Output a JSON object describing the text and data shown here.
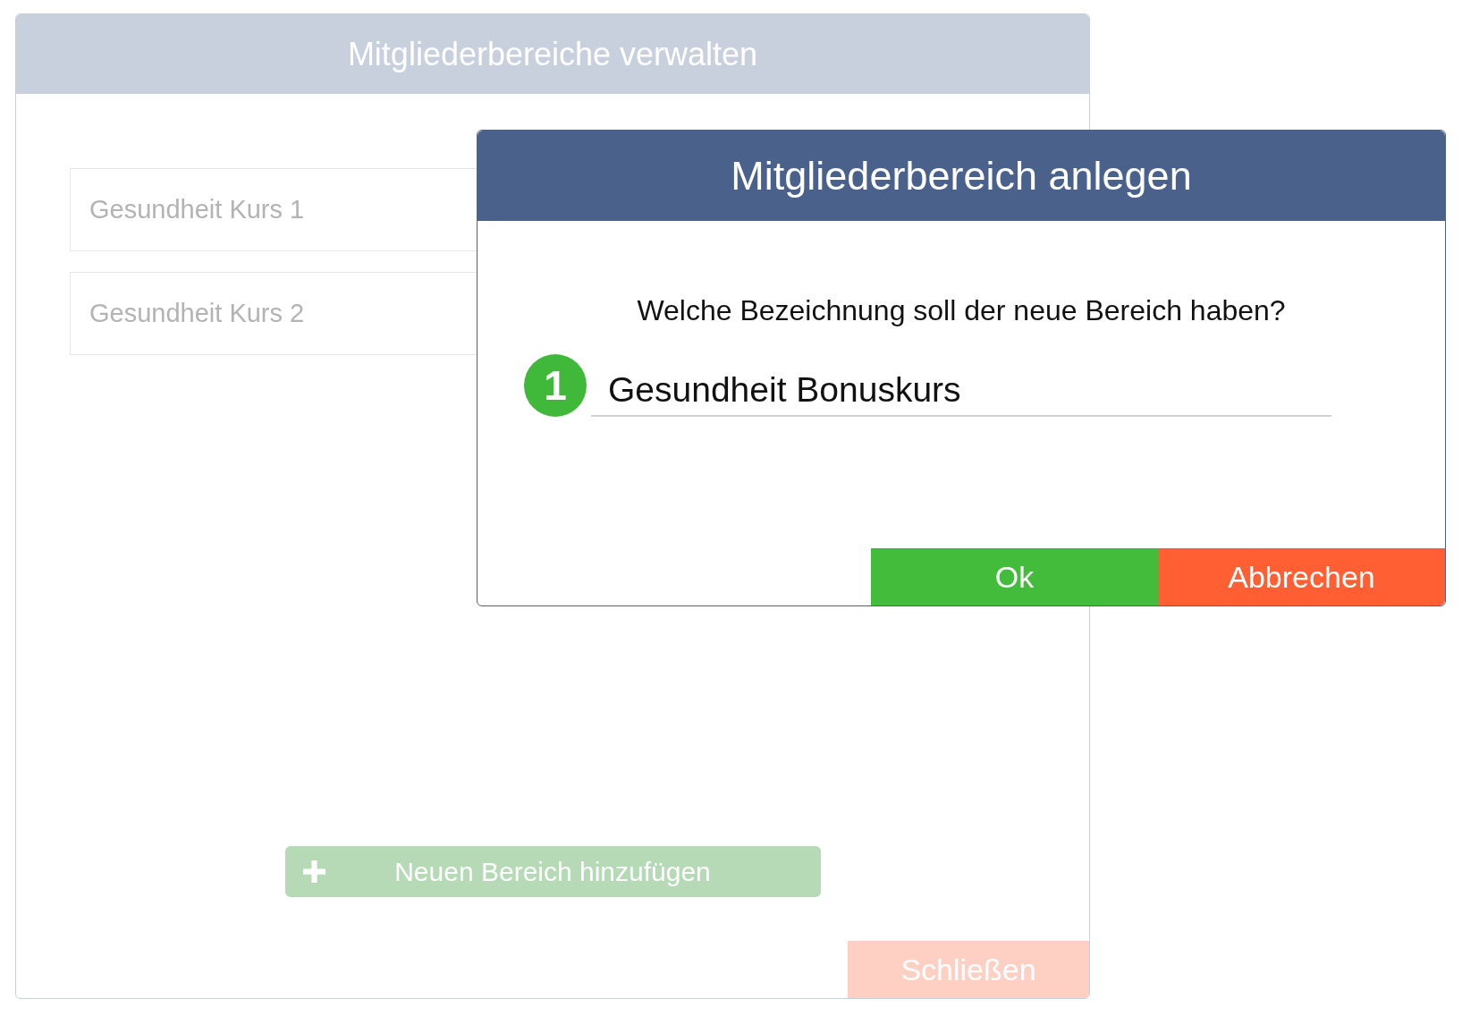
{
  "background_dialog": {
    "title": "Mitgliederbereiche verwalten",
    "areas": [
      {
        "value": "Gesundheit Kurs 1"
      },
      {
        "value": "Gesundheit Kurs 2"
      }
    ],
    "add_button": {
      "label": "Neuen Bereich hinzufügen"
    },
    "close_button": {
      "label": "Schließen"
    }
  },
  "dialog": {
    "title": "Mitgliederbereich anlegen",
    "prompt": "Welche Bezeichnung soll der neue Bereich haben?",
    "step_badge": "1",
    "name_field": {
      "value": "Gesundheit Bonuskurs"
    },
    "buttons": [
      {
        "label": "Ok",
        "kind": "confirm"
      },
      {
        "label": "Abbrechen",
        "kind": "cancel"
      }
    ]
  }
}
